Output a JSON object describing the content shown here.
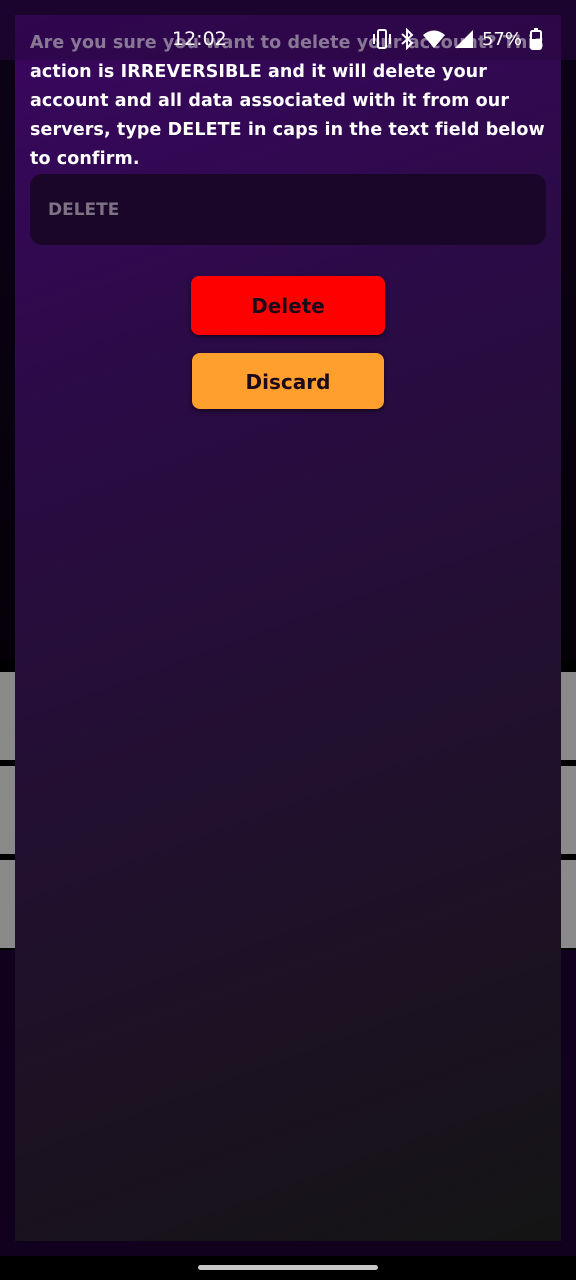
{
  "status_bar": {
    "time": "12:02",
    "battery_percent": "57%",
    "icons": [
      "vibrate-icon",
      "bluetooth-icon",
      "wifi-icon",
      "cellular-signal-icon",
      "battery-icon"
    ]
  },
  "dialog": {
    "message": "Are you sure you want to delete your account? This action is IRREVERSIBLE and it will delete your account and all data associated with it from our servers, type DELETE in caps in the text field below to confirm.",
    "confirm_field": {
      "value": "",
      "placeholder": "DELETE"
    },
    "delete_label": "Delete",
    "discard_label": "Discard"
  },
  "colors": {
    "delete_button": "#ff0000",
    "discard_button": "#ff9f2e",
    "dialog_top": "#3a0660",
    "dialog_bottom": "#141414"
  }
}
